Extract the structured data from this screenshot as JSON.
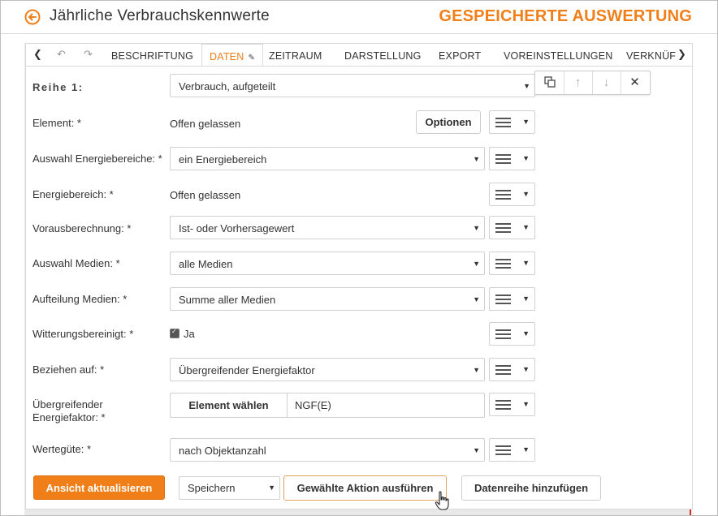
{
  "header": {
    "title": "Jährliche Verbrauchskennwerte",
    "saved_title": "GESPEICHERTE AUSWERTUNG"
  },
  "tabs": [
    {
      "label": "BESCHRIFTUNG"
    },
    {
      "label": "DATEN",
      "active": true
    },
    {
      "label": "ZEITRAUM"
    },
    {
      "label": "DARSTELLUNG"
    },
    {
      "label": "EXPORT"
    },
    {
      "label": "VOREINSTELLUNGEN"
    },
    {
      "label": "VERKNÜF"
    }
  ],
  "series": {
    "label": "Reihe 1:",
    "value": "Verbrauch, aufgeteilt"
  },
  "rows": {
    "element": {
      "label": "Element: *",
      "value": "Offen gelassen",
      "button": "Optionen"
    },
    "auswahl_energie": {
      "label": "Auswahl Energiebereiche: *",
      "value": "ein Energiebereich"
    },
    "energiebereich": {
      "label": "Energiebereich: *",
      "value": "Offen gelassen"
    },
    "vorausberechnung": {
      "label": "Vorausberechnung: *",
      "value": "Ist- oder Vorhersagewert"
    },
    "auswahl_medien": {
      "label": "Auswahl Medien: *",
      "value": "alle Medien"
    },
    "aufteilung_medien": {
      "label": "Aufteilung Medien: *",
      "value": "Summe aller Medien"
    },
    "witterung": {
      "label": "Witterungsbereinigt: *",
      "value": "Ja",
      "checked": true
    },
    "beziehen": {
      "label": "Beziehen auf: *",
      "value": "Übergreifender Energiefaktor"
    },
    "faktor": {
      "label_line1": "Übergreifender",
      "label_line2": "Energiefaktor: *",
      "button": "Element wählen",
      "value": "NGF(E)"
    },
    "wertegute": {
      "label": "Wertegüte: *",
      "value": "nach Objektanzahl"
    }
  },
  "footer": {
    "refresh": "Ansicht aktualisieren",
    "save_select": "Speichern",
    "run": "Gewählte Aktion ausführen",
    "add": "Datenreihe hinzufügen"
  },
  "colors": {
    "accent": "#f07f1a",
    "red_line": "#c9332a"
  }
}
